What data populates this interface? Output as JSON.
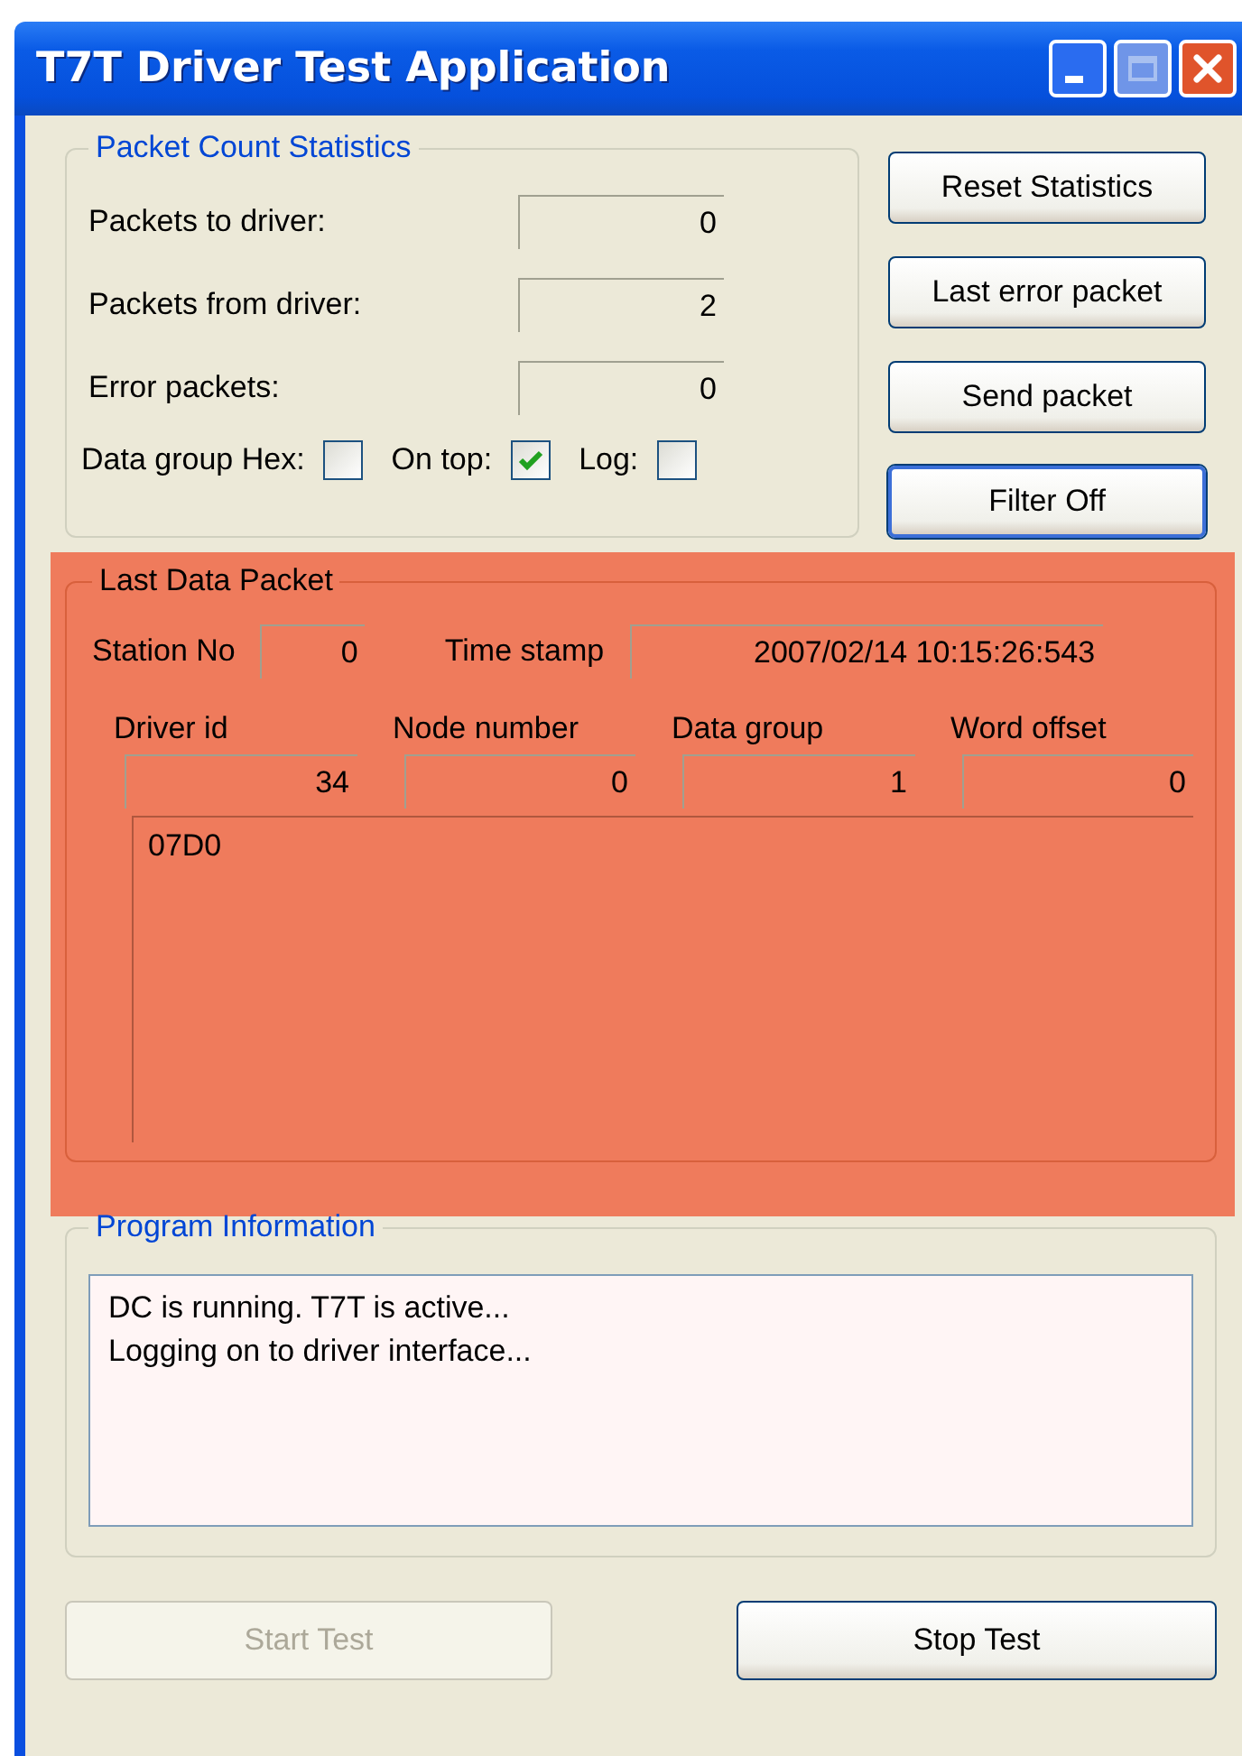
{
  "window": {
    "title": "T7T Driver Test Application"
  },
  "packet_stats": {
    "title": "Packet Count Statistics",
    "rows": [
      {
        "label": "Packets to driver:",
        "value": "0"
      },
      {
        "label": "Packets from driver:",
        "value": "2"
      },
      {
        "label": "Error packets:",
        "value": "0"
      }
    ],
    "options": [
      {
        "label": "Data group Hex:",
        "checked": false
      },
      {
        "label": "On top:",
        "checked": true
      },
      {
        "label": "Log:",
        "checked": false
      }
    ]
  },
  "side_buttons": [
    {
      "label": "Reset Statistics",
      "default": false
    },
    {
      "label": "Last error packet",
      "default": false
    },
    {
      "label": "Send packet",
      "default": false
    },
    {
      "label": "Filter Off",
      "default": true
    }
  ],
  "last_packet": {
    "title": "Last Data Packet",
    "highlighted": true,
    "station_label": "Station No",
    "station_value": "0",
    "timestamp_label": "Time stamp",
    "timestamp_value": "2007/02/14 10:15:26:543",
    "columns": [
      {
        "label": "Driver id",
        "value": "34"
      },
      {
        "label": "Node number",
        "value": "0"
      },
      {
        "label": "Data group",
        "value": "1"
      },
      {
        "label": "Word offset",
        "value": "0"
      }
    ],
    "data": "07D0"
  },
  "program_info": {
    "title": "Program Information",
    "lines": [
      "DC is running. T7T is active...",
      "Logging on to driver interface..."
    ]
  },
  "bottom_buttons": [
    {
      "label": "Start Test",
      "disabled": true
    },
    {
      "label": "Stop Test",
      "disabled": false
    }
  ]
}
